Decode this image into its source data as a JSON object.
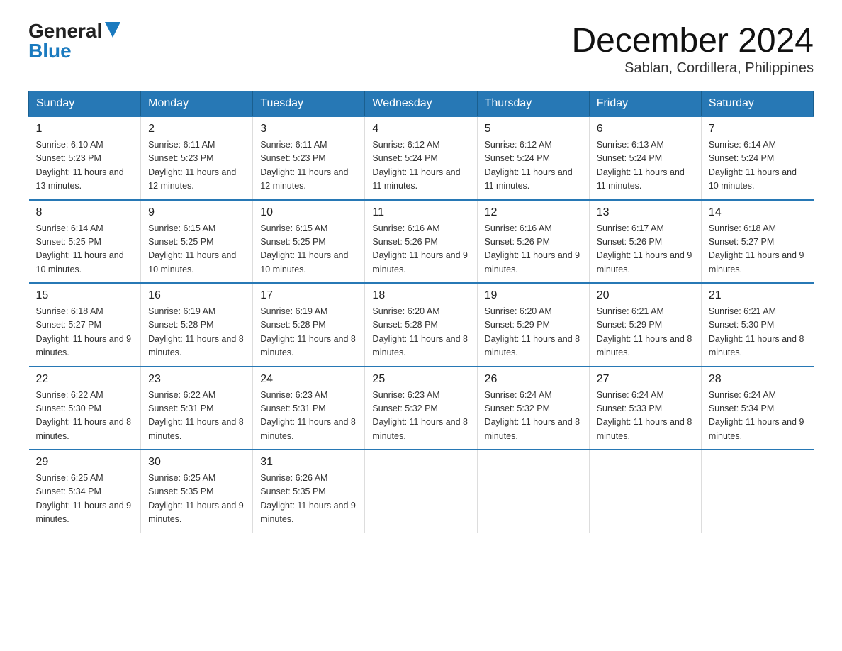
{
  "logo": {
    "text_general": "General",
    "text_blue": "Blue"
  },
  "title": {
    "month_year": "December 2024",
    "location": "Sablan, Cordillera, Philippines"
  },
  "weekdays": [
    "Sunday",
    "Monday",
    "Tuesday",
    "Wednesday",
    "Thursday",
    "Friday",
    "Saturday"
  ],
  "weeks": [
    [
      {
        "day": "1",
        "sunrise": "6:10 AM",
        "sunset": "5:23 PM",
        "daylight": "11 hours and 13 minutes."
      },
      {
        "day": "2",
        "sunrise": "6:11 AM",
        "sunset": "5:23 PM",
        "daylight": "11 hours and 12 minutes."
      },
      {
        "day": "3",
        "sunrise": "6:11 AM",
        "sunset": "5:23 PM",
        "daylight": "11 hours and 12 minutes."
      },
      {
        "day": "4",
        "sunrise": "6:12 AM",
        "sunset": "5:24 PM",
        "daylight": "11 hours and 11 minutes."
      },
      {
        "day": "5",
        "sunrise": "6:12 AM",
        "sunset": "5:24 PM",
        "daylight": "11 hours and 11 minutes."
      },
      {
        "day": "6",
        "sunrise": "6:13 AM",
        "sunset": "5:24 PM",
        "daylight": "11 hours and 11 minutes."
      },
      {
        "day": "7",
        "sunrise": "6:14 AM",
        "sunset": "5:24 PM",
        "daylight": "11 hours and 10 minutes."
      }
    ],
    [
      {
        "day": "8",
        "sunrise": "6:14 AM",
        "sunset": "5:25 PM",
        "daylight": "11 hours and 10 minutes."
      },
      {
        "day": "9",
        "sunrise": "6:15 AM",
        "sunset": "5:25 PM",
        "daylight": "11 hours and 10 minutes."
      },
      {
        "day": "10",
        "sunrise": "6:15 AM",
        "sunset": "5:25 PM",
        "daylight": "11 hours and 10 minutes."
      },
      {
        "day": "11",
        "sunrise": "6:16 AM",
        "sunset": "5:26 PM",
        "daylight": "11 hours and 9 minutes."
      },
      {
        "day": "12",
        "sunrise": "6:16 AM",
        "sunset": "5:26 PM",
        "daylight": "11 hours and 9 minutes."
      },
      {
        "day": "13",
        "sunrise": "6:17 AM",
        "sunset": "5:26 PM",
        "daylight": "11 hours and 9 minutes."
      },
      {
        "day": "14",
        "sunrise": "6:18 AM",
        "sunset": "5:27 PM",
        "daylight": "11 hours and 9 minutes."
      }
    ],
    [
      {
        "day": "15",
        "sunrise": "6:18 AM",
        "sunset": "5:27 PM",
        "daylight": "11 hours and 9 minutes."
      },
      {
        "day": "16",
        "sunrise": "6:19 AM",
        "sunset": "5:28 PM",
        "daylight": "11 hours and 8 minutes."
      },
      {
        "day": "17",
        "sunrise": "6:19 AM",
        "sunset": "5:28 PM",
        "daylight": "11 hours and 8 minutes."
      },
      {
        "day": "18",
        "sunrise": "6:20 AM",
        "sunset": "5:28 PM",
        "daylight": "11 hours and 8 minutes."
      },
      {
        "day": "19",
        "sunrise": "6:20 AM",
        "sunset": "5:29 PM",
        "daylight": "11 hours and 8 minutes."
      },
      {
        "day": "20",
        "sunrise": "6:21 AM",
        "sunset": "5:29 PM",
        "daylight": "11 hours and 8 minutes."
      },
      {
        "day": "21",
        "sunrise": "6:21 AM",
        "sunset": "5:30 PM",
        "daylight": "11 hours and 8 minutes."
      }
    ],
    [
      {
        "day": "22",
        "sunrise": "6:22 AM",
        "sunset": "5:30 PM",
        "daylight": "11 hours and 8 minutes."
      },
      {
        "day": "23",
        "sunrise": "6:22 AM",
        "sunset": "5:31 PM",
        "daylight": "11 hours and 8 minutes."
      },
      {
        "day": "24",
        "sunrise": "6:23 AM",
        "sunset": "5:31 PM",
        "daylight": "11 hours and 8 minutes."
      },
      {
        "day": "25",
        "sunrise": "6:23 AM",
        "sunset": "5:32 PM",
        "daylight": "11 hours and 8 minutes."
      },
      {
        "day": "26",
        "sunrise": "6:24 AM",
        "sunset": "5:32 PM",
        "daylight": "11 hours and 8 minutes."
      },
      {
        "day": "27",
        "sunrise": "6:24 AM",
        "sunset": "5:33 PM",
        "daylight": "11 hours and 8 minutes."
      },
      {
        "day": "28",
        "sunrise": "6:24 AM",
        "sunset": "5:34 PM",
        "daylight": "11 hours and 9 minutes."
      }
    ],
    [
      {
        "day": "29",
        "sunrise": "6:25 AM",
        "sunset": "5:34 PM",
        "daylight": "11 hours and 9 minutes."
      },
      {
        "day": "30",
        "sunrise": "6:25 AM",
        "sunset": "5:35 PM",
        "daylight": "11 hours and 9 minutes."
      },
      {
        "day": "31",
        "sunrise": "6:26 AM",
        "sunset": "5:35 PM",
        "daylight": "11 hours and 9 minutes."
      },
      null,
      null,
      null,
      null
    ]
  ]
}
